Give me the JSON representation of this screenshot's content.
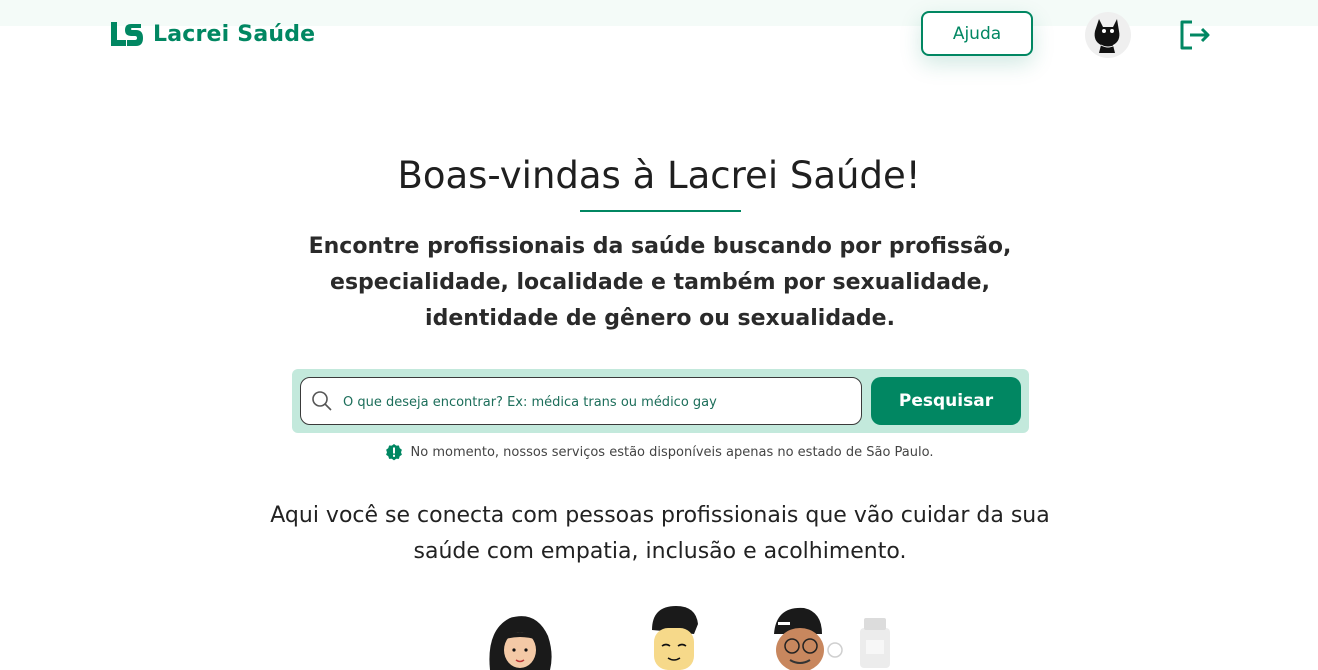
{
  "header": {
    "brand": "Lacrei Saúde",
    "help_label": "Ajuda",
    "avatar_icon": "cat-avatar",
    "logout_icon": "logout-icon"
  },
  "hero": {
    "title": "Boas-vindas à Lacrei Saúde!",
    "subtitle": "Encontre profissionais da saúde buscando por profissão, especialidade, localidade e também por sexualidade, identidade de gênero ou sexualidade."
  },
  "search": {
    "placeholder": "O que deseja encontrar? Ex: médica trans ou médico gay",
    "button_label": "Pesquisar"
  },
  "notice": {
    "text": "No momento, nossos serviços estão disponíveis apenas no estado de São Paulo."
  },
  "tagline": "Aqui você se conecta com pessoas profissionais que vão cuidar da sua saúde com empatia, inclusão e acolhimento.",
  "colors": {
    "brand": "#018762",
    "search_bg": "#c3e9dc"
  }
}
